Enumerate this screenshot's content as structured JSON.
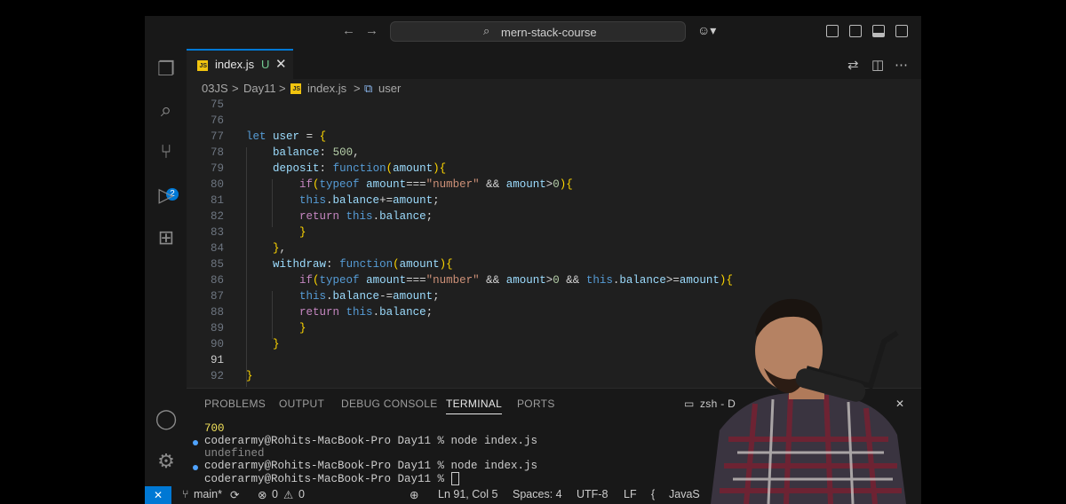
{
  "titlebar": {
    "back_icon": "←",
    "forward_icon": "→",
    "search_text": "mern-stack-course"
  },
  "tab": {
    "label": "index.js",
    "status": "U",
    "close": "✕"
  },
  "breadcrumb": {
    "items": [
      "03JS",
      "Day11",
      "index.js",
      "user"
    ],
    "separator": ">"
  },
  "editor": {
    "current_line": 91,
    "lines": [
      {
        "n": "75"
      },
      {
        "n": "76"
      },
      {
        "n": "77"
      },
      {
        "n": "78"
      },
      {
        "n": "79"
      },
      {
        "n": "80"
      },
      {
        "n": "81"
      },
      {
        "n": "82"
      },
      {
        "n": "83"
      },
      {
        "n": "84"
      },
      {
        "n": "85"
      },
      {
        "n": "86"
      },
      {
        "n": "87"
      },
      {
        "n": "88"
      },
      {
        "n": "89"
      },
      {
        "n": "90"
      },
      {
        "n": "91"
      },
      {
        "n": "92"
      }
    ],
    "code": [
      "",
      "",
      "let user = {",
      "    balance: 500,",
      "    deposit: function(amount){",
      "        if(typeof amount===\"number\" && amount>0){",
      "        this.balance+=amount;",
      "        return this.balance;",
      "        }",
      "    },",
      "    withdraw: function(amount){",
      "        if(typeof amount===\"number\" && amount>0 && this.balance>=amount){",
      "        this.balance-=amount;",
      "        return this.balance;",
      "        }",
      "    }",
      "",
      "}"
    ]
  },
  "panel": {
    "tabs": [
      "PROBLEMS",
      "OUTPUT",
      "DEBUG CONSOLE",
      "TERMINAL",
      "PORTS"
    ],
    "active_tab": "TERMINAL",
    "terminal_name": "zsh - D",
    "close": "✕",
    "terminal_lines": [
      "700",
      "coderarmy@Rohits-MacBook-Pro Day11 % node index.js",
      "undefined",
      "coderarmy@Rohits-MacBook-Pro Day11 % node index.js",
      "coderarmy@Rohits-MacBook-Pro Day11 % "
    ]
  },
  "statusbar": {
    "remote_icon": "✕",
    "branch": "main*",
    "errors": "0",
    "warnings": "0",
    "position": "Ln 91, Col 5",
    "spaces": "Spaces: 4",
    "encoding": "UTF-8",
    "eol": "LF",
    "language": "JavaS"
  },
  "activity": {
    "scm_badge": "2"
  },
  "colors": {
    "accent": "#0078d4",
    "editor_bg": "#1f1f1f",
    "keyword": "#569cd6",
    "string": "#ce9178"
  }
}
